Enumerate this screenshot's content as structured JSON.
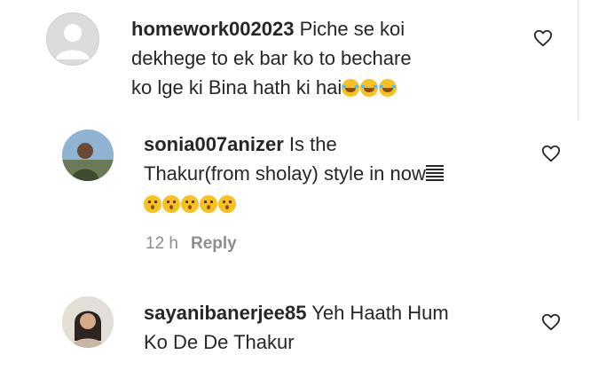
{
  "comments": [
    {
      "username": "homework002023",
      "text": "Piche se koi dekhege to ek bar ko to bechare ko lge ki Bina hath ki hai",
      "line1": "Piche se koi",
      "line2": "dekhege to ek bar ko to bechare",
      "line3": "ko lge ki Bina hath ki hai",
      "emojis": [
        "laughing-tears",
        "laughing-tears",
        "laughing-tears"
      ],
      "avatar": "default-avatar"
    },
    {
      "username": "sonia007anizer",
      "line1": "Is the",
      "line2": "Thakur(from sholay) style in now",
      "emojis": [
        "hushed-face",
        "hushed-face",
        "hushed-face",
        "hushed-face",
        "hushed-face"
      ],
      "time": "12 h",
      "reply": "Reply",
      "avatar": "profile-photo"
    },
    {
      "username": "sayanibanerjee85",
      "line1": "Yeh Haath Hum",
      "line2": "Ko De De Thakur",
      "avatar": "profile-photo"
    }
  ],
  "colors": {
    "text": "#262626",
    "meta": "#8e8e8e",
    "heart_stroke": "#262626",
    "emoji": "#f7c21f"
  }
}
